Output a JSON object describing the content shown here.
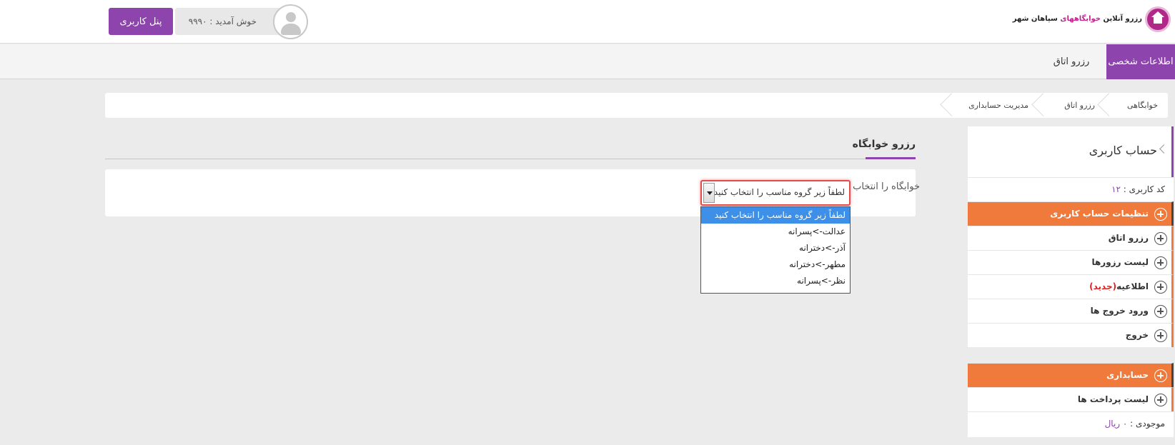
{
  "header": {
    "logo_text_prefix": "رزرو آنلاین",
    "logo_text_highlight": "خوابگاههای",
    "logo_text_suffix": "سپاهان شهر",
    "welcome_text": "خوش آمدید : ۹۹۹۰",
    "panel_button": "پنل کاربری"
  },
  "nav": {
    "active": "اطلاعات شخصی",
    "reservation": "رزرو اتاق"
  },
  "breadcrumb": {
    "items": [
      "خوابگاهی",
      "رزرو اتاق",
      "مدیریت حسابداری"
    ]
  },
  "main": {
    "title": "رزرو خوابگاه",
    "form_label": "خوابگاه را انتخاب کنید",
    "select_value": "لطفاً زیر گروه مناسب را انتخاب کنید",
    "options": [
      "لطفاً زیر گروه مناسب را انتخاب کنید",
      "عدالت->پسرانه",
      "آذر->دخترانه",
      "مطهر->دخترانه",
      "نظر->پسرانه"
    ]
  },
  "sidebar": {
    "title": "حساب کاربری",
    "user_code_label": "کد کاربری : ",
    "user_code_value": "۱۲",
    "settings": "تنظیمات حساب کاربری",
    "room_reserve": "رزرو اتاق",
    "reserve_list": "لیست رزورها",
    "notice": "اطلاعیه",
    "notice_new": "(جدید)",
    "entry_exit": "ورود خروج ها",
    "logout": "خروج",
    "accounting": "حسابداری",
    "payments": "لیست پرداخت ها",
    "balance_label": "موجودی : ",
    "balance_value": "۰ ریال"
  },
  "colors": {
    "purple": "#8e44ad",
    "orange": "#f07a3c",
    "select_highlight": "#3d8fe8"
  }
}
